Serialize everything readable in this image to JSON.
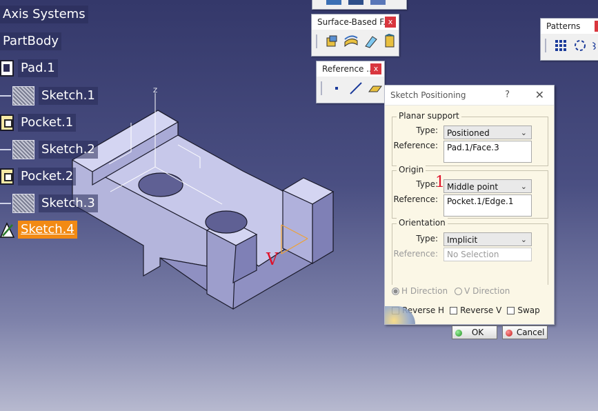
{
  "tree": {
    "axis_systems": "Axis Systems",
    "partbody": "PartBody",
    "pad1": "Pad.1",
    "sketch1": "Sketch.1",
    "pocket1": "Pocket.1",
    "sketch2": "Sketch.2",
    "pocket2": "Pocket.2",
    "sketch3": "Sketch.3",
    "sketch4": "Sketch.4"
  },
  "toolbars": {
    "surface_based": "Surface-Based F...",
    "reference": "Reference ...",
    "patterns": "Patterns",
    "close_glyph": "x"
  },
  "viewport": {
    "axis_z": "Z",
    "red_mark": "V"
  },
  "dialog": {
    "title": "Sketch Positioning",
    "help": "?",
    "close": "✕",
    "planar_support": {
      "title": "Planar support",
      "type_label": "Type:",
      "type_value": "Positioned",
      "reference_label": "Reference:",
      "reference_value": "Pad.1/Face.3"
    },
    "origin": {
      "title": "Origin",
      "type_label": "Type:",
      "type_value": "Middle point",
      "reference_label": "Reference:",
      "reference_value": "Pocket.1/Edge.1",
      "red_mark": "1"
    },
    "orientation": {
      "title": "Orientation",
      "type_label": "Type:",
      "type_value": "Implicit",
      "reference_label": "Reference:",
      "reference_value": "No Selection"
    },
    "h_direction": "H Direction",
    "v_direction": "V Direction",
    "reverse_h": "Reverse H",
    "reverse_v": "Reverse V",
    "swap": "Swap",
    "ok": "OK",
    "cancel": "Cancel"
  },
  "colors": {
    "selection": "#f28a14",
    "background_top": "#34386a",
    "part_face": "#c9cae8",
    "dialog_bg": "#fbf7e6"
  }
}
